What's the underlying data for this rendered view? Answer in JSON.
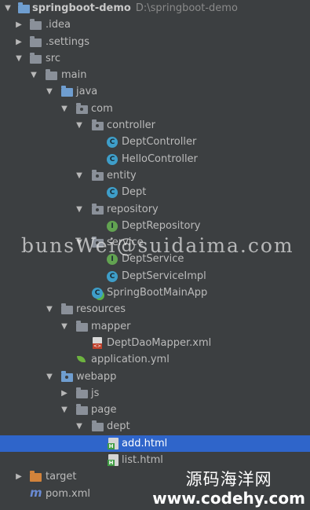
{
  "tree": {
    "root": {
      "name": "springboot-demo",
      "path": "D:\\springboot-demo"
    },
    "idea": "idea",
    "settings": ".settings",
    "src": "src",
    "main": "main",
    "java": "java",
    "com": "com",
    "controller": "controller",
    "dept_controller": "DeptController",
    "hello_controller": "HelloController",
    "entity": "entity",
    "dept": "Dept",
    "repository": "repository",
    "dept_repository": "DeptRepository",
    "service": "service",
    "dept_service": "DeptService",
    "dept_service_impl": "DeptServiceImpl",
    "main_app": "SpringBootMainApp",
    "resources": "resources",
    "mapper": "mapper",
    "dept_dao_mapper": "DeptDaoMapper.xml",
    "application_yml": "application.yml",
    "webapp": "webapp",
    "js": "js",
    "page": "page",
    "dept_folder": "dept",
    "add_html": "add.html",
    "list_html": "list.html",
    "target": "target",
    "pom": "pom.xml"
  },
  "watermarks": {
    "center": "bunsWei@suidaima.com",
    "corner_cn": "源码海洋网",
    "corner_url": "www.codehy.com"
  },
  "colors": {
    "background": "#3c3f41",
    "selection": "#2f65ca",
    "class_icon": "#3e9ec9",
    "interface_icon": "#62a351",
    "target_folder": "#d2833b"
  }
}
